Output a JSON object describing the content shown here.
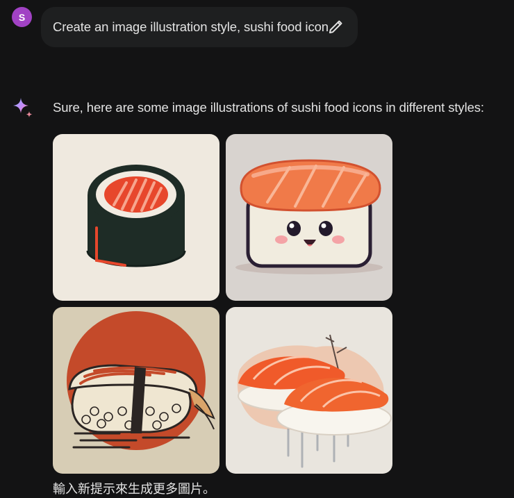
{
  "user": {
    "avatar_initial": "S",
    "avatar_color": "#a142c4"
  },
  "prompt": {
    "text": "Create an image illustration style, sushi food icon",
    "edit_icon": "pencil-icon"
  },
  "response": {
    "icon": "sparkle-icon",
    "text": "Sure, here are some image illustrations of sushi food icons in different styles:",
    "images": [
      {
        "style": "maki roll flat icon"
      },
      {
        "style": "kawaii nigiri character"
      },
      {
        "style": "vintage print nigiri with red sun"
      },
      {
        "style": "watercolor salmon nigiri"
      }
    ],
    "footer": "輸入新提示來生成更多圖片。"
  },
  "colors": {
    "background": "#131314",
    "bubble": "#1e1f20",
    "text": "#e3e3e3"
  }
}
